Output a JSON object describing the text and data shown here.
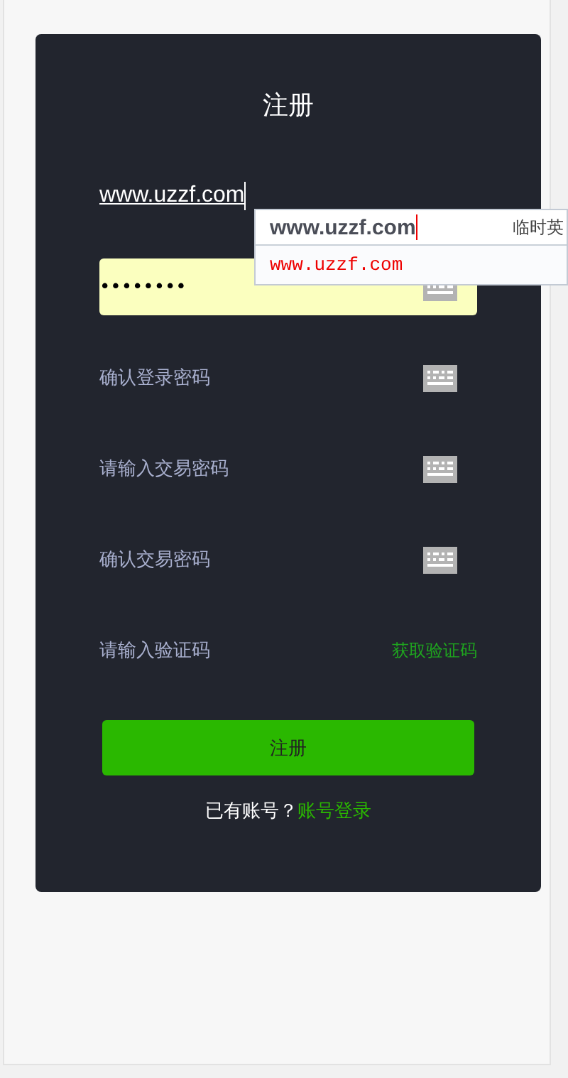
{
  "title": "注册",
  "fields": [
    {
      "kind": "text",
      "value": "www.uzzf.com",
      "focused": true
    },
    {
      "kind": "password",
      "value": "••••••••",
      "autofilled": true,
      "keyboard": true
    },
    {
      "kind": "password",
      "placeholder": "确认登录密码",
      "keyboard": true
    },
    {
      "kind": "password",
      "placeholder": "请输入交易密码",
      "keyboard": true
    },
    {
      "kind": "password",
      "placeholder": "确认交易密码",
      "keyboard": true
    },
    {
      "kind": "code",
      "placeholder": "请输入验证码",
      "action": "获取验证码"
    }
  ],
  "submit": "注册",
  "footer": {
    "text": "已有账号？",
    "link": "账号登录"
  },
  "ime": {
    "composition": "www.uzzf.com",
    "hint": "临时英",
    "candidates": [
      "www.uzzf.com"
    ]
  }
}
